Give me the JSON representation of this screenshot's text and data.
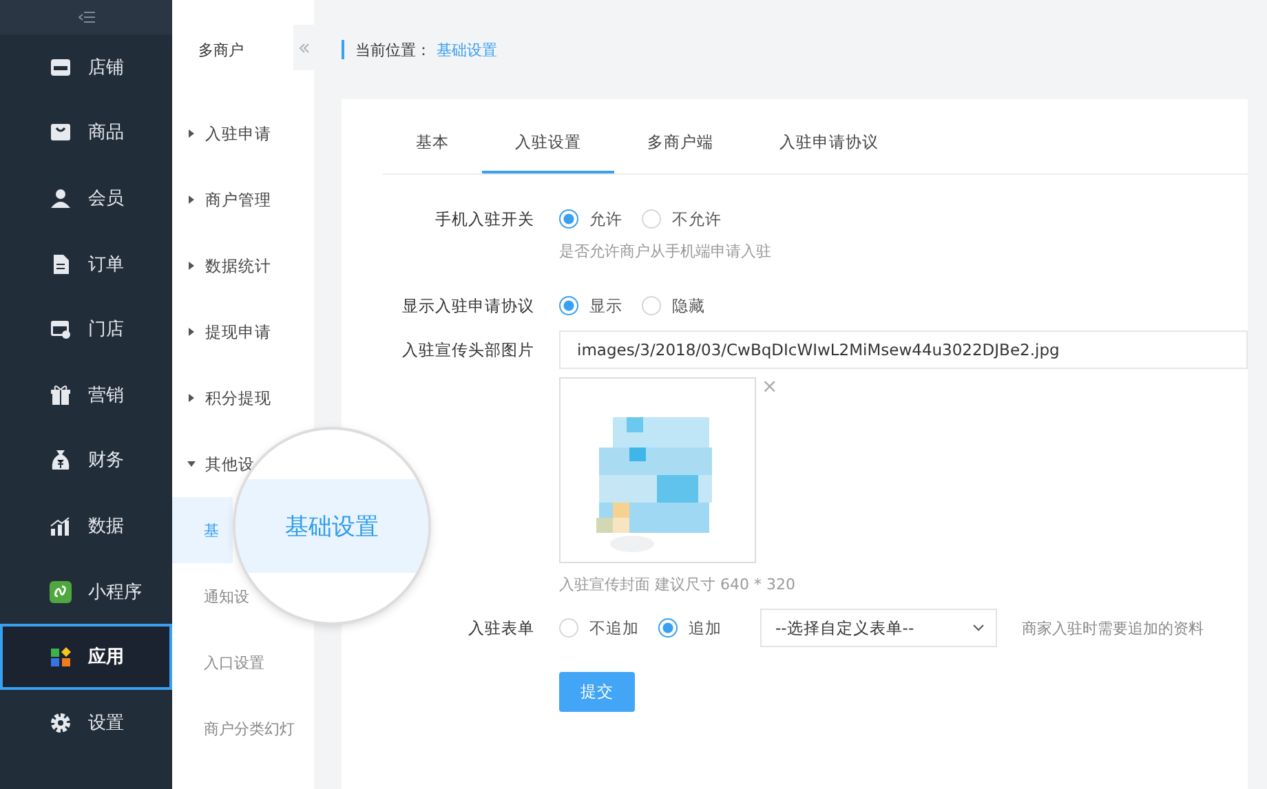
{
  "nav": [
    {
      "label": "店铺",
      "selected": false
    },
    {
      "label": "商品",
      "selected": false
    },
    {
      "label": "会员",
      "selected": false
    },
    {
      "label": "订单",
      "selected": false
    },
    {
      "label": "门店",
      "selected": false
    },
    {
      "label": "营销",
      "selected": false
    },
    {
      "label": "财务",
      "selected": false
    },
    {
      "label": "数据",
      "selected": false
    },
    {
      "label": "小程序",
      "selected": false
    },
    {
      "label": "应用",
      "selected": true
    },
    {
      "label": "设置",
      "selected": false
    }
  ],
  "submenu": {
    "title": "多商户",
    "items": [
      {
        "label": "入驻申请",
        "expanded": false
      },
      {
        "label": "商户管理",
        "expanded": false
      },
      {
        "label": "数据统计",
        "expanded": false
      },
      {
        "label": "提现申请",
        "expanded": false
      },
      {
        "label": "积分提现",
        "expanded": false
      },
      {
        "label": "其他设",
        "expanded": true,
        "children": [
          {
            "label": "基",
            "selected": true
          },
          {
            "label": "通知设",
            "selected": false
          },
          {
            "label": "入口设置",
            "selected": false
          },
          {
            "label": "商户分类幻灯",
            "selected": false
          }
        ]
      }
    ]
  },
  "magnifier": {
    "label": "基础设置"
  },
  "breadcrumb": {
    "label": "当前位置：",
    "current": "基础设置"
  },
  "tabs": [
    {
      "label": "基本",
      "selected": false
    },
    {
      "label": "入驻设置",
      "selected": true
    },
    {
      "label": "多商户端",
      "selected": false
    },
    {
      "label": "入驻申请协议",
      "selected": false
    }
  ],
  "fields": [
    {
      "kind": "radio",
      "label": "手机入驻开关",
      "options": [
        {
          "label": "允许",
          "selected": true
        },
        {
          "label": "不允许",
          "selected": false
        }
      ],
      "help": "是否允许商户从手机端申请入驻"
    },
    {
      "kind": "radio",
      "label": "显示入驻申请协议",
      "options": [
        {
          "label": "显示",
          "selected": true
        },
        {
          "label": "隐藏",
          "selected": false
        }
      ]
    },
    {
      "label": "入驻宣传头部图片",
      "value": "images/3/2018/03/CwBqDIcWIwL2MiMsew44u3022DJBe2.jpg",
      "remove": "×",
      "help": "入驻宣传封面 建议尺寸 640 * 320"
    },
    {
      "kind": "radio",
      "label": "入驻表单",
      "options": [
        {
          "label": "不追加",
          "selected": false
        },
        {
          "label": "追加",
          "selected": true
        }
      ],
      "select": "--选择自定义表单--",
      "note": "商家入驻时需要追加的资料"
    }
  ],
  "submit": "提交"
}
